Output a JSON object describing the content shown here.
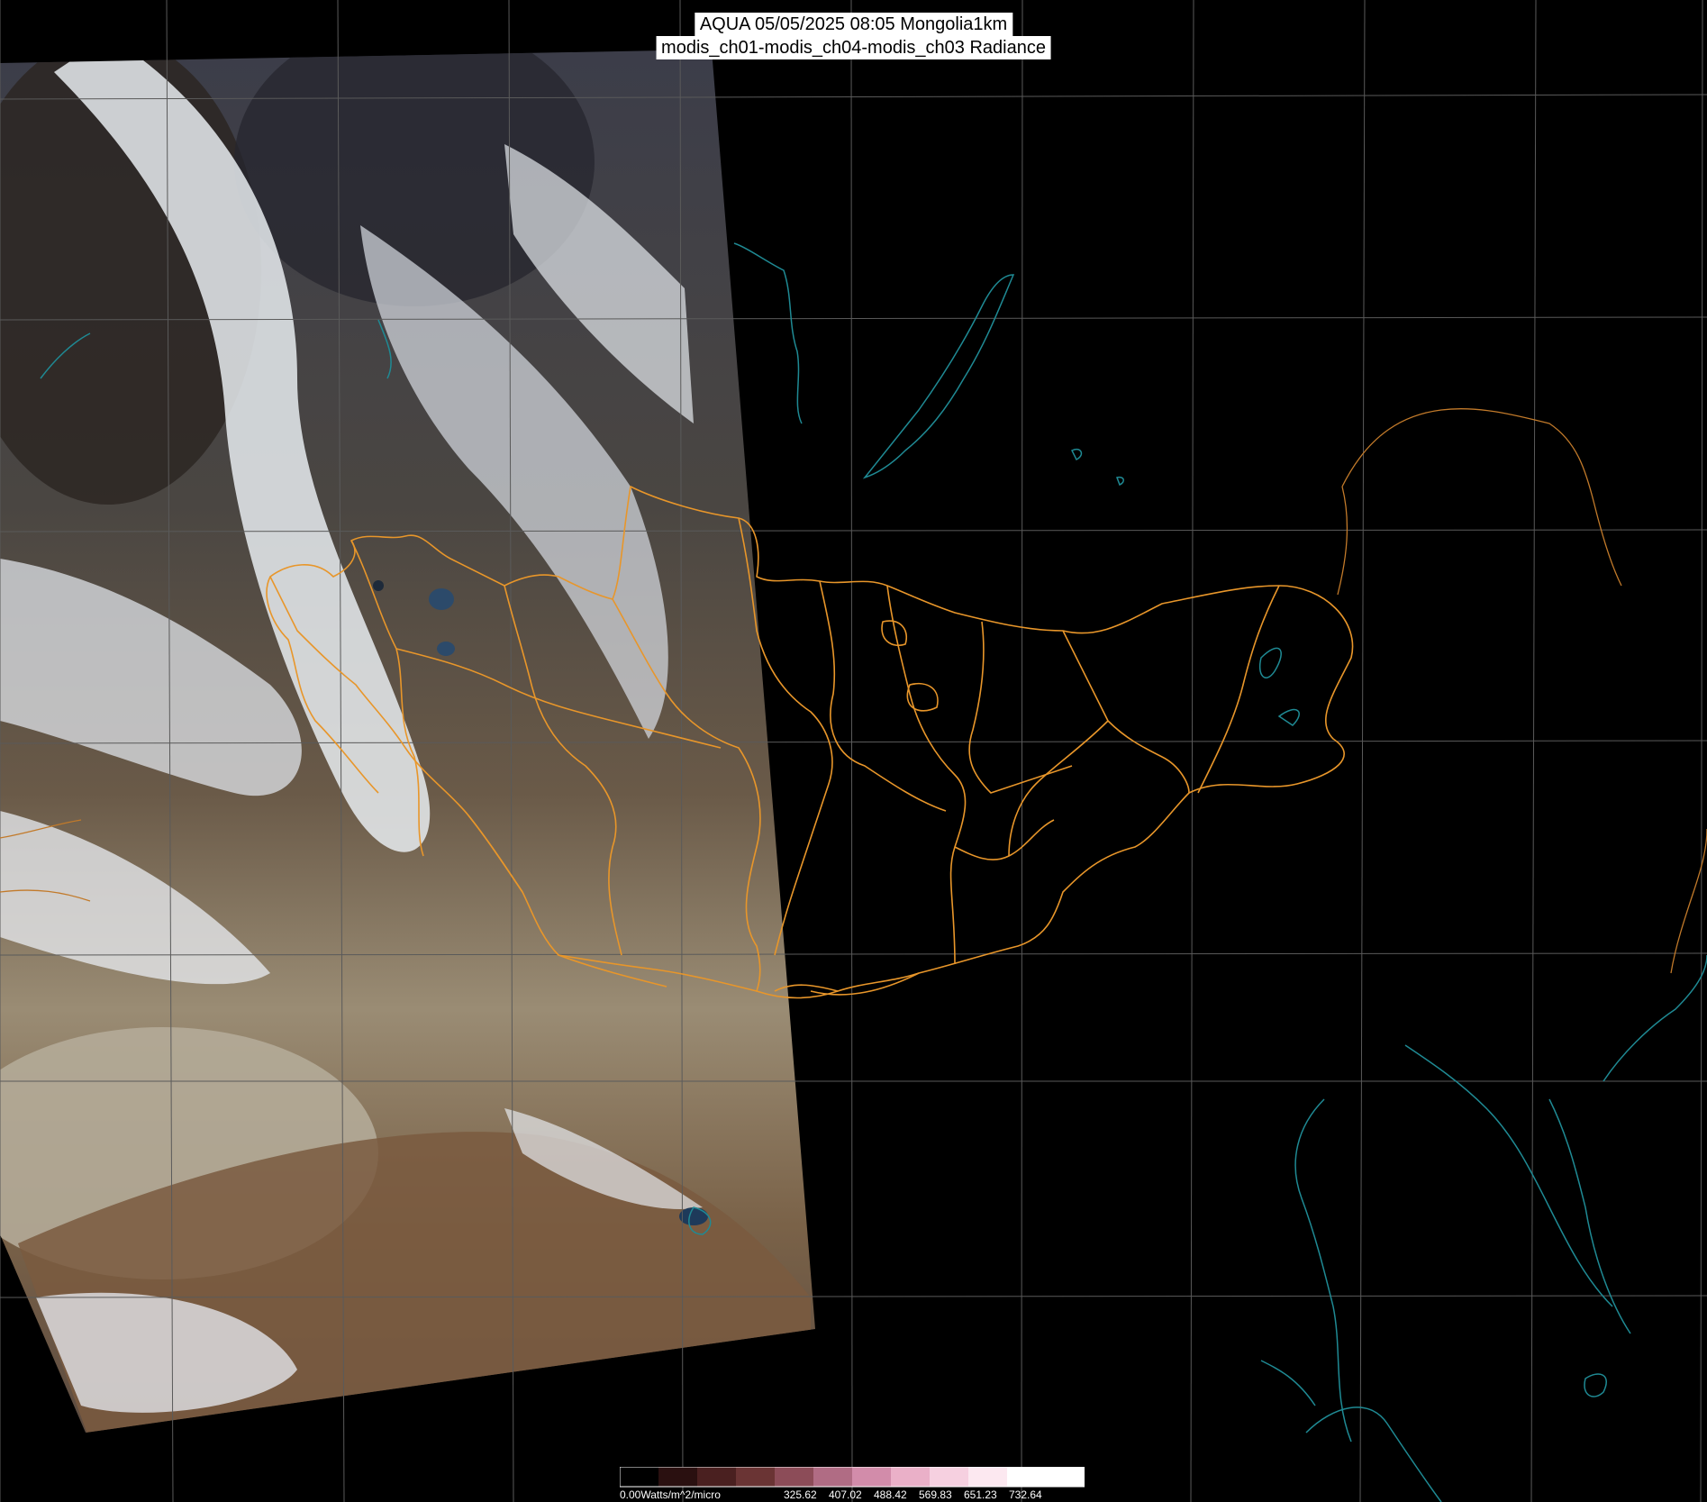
{
  "header": {
    "line1": "AQUA 05/05/2025 08:05 Mongolia1km",
    "line2": "modis_ch01-modis_ch04-modis_ch03 Radiance"
  },
  "colorbar": {
    "first_label": "0.00Watts/m^2/micro",
    "tick_labels": [
      "325.62",
      "407.02",
      "488.42",
      "569.83",
      "651.23",
      "732.64"
    ],
    "colors": [
      "#000000",
      "#2a1010",
      "#4a2020",
      "#6a3434",
      "#8c4c58",
      "#b06c84",
      "#d28caa",
      "#eab0c8",
      "#f6d0e0",
      "#fce8f0",
      "#ffffff",
      "#ffffff"
    ]
  },
  "map": {
    "background": "#000000",
    "grid_color": "#5a5a5a",
    "border_color": "#e8962a",
    "coast_color": "#1f8a94"
  }
}
